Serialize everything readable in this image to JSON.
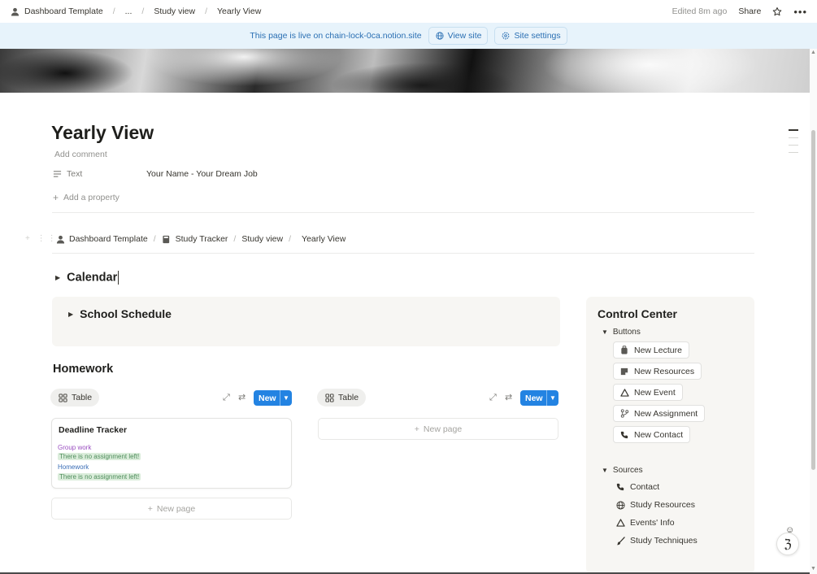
{
  "topbar": {
    "breadcrumb": [
      "Dashboard Template",
      "...",
      "Study view",
      "Yearly View"
    ],
    "edited": "Edited 8m ago",
    "share": "Share"
  },
  "banner": {
    "text": "This page is live on chain-lock-0ca.notion.site",
    "view_site": "View site",
    "site_settings": "Site settings"
  },
  "page": {
    "title": "Yearly View",
    "add_comment": "Add comment",
    "property_name": "Text",
    "property_value": "Your Name - Your Dream Job",
    "add_property": "Add a property"
  },
  "inner_breadcrumb": [
    "Dashboard Template",
    "Study Tracker",
    "Study view",
    "Yearly View"
  ],
  "calendar": {
    "label": "Calendar"
  },
  "school": {
    "label": "School Schedule"
  },
  "homework": {
    "heading": "Homework",
    "left_table": {
      "view": "Table",
      "new": "New",
      "card_title": "Deadline Tracker",
      "tags": [
        {
          "text": "Group work",
          "style": "purple"
        },
        {
          "text": "There is no assignment left!",
          "style": "green"
        },
        {
          "text": "Homework",
          "style": "blue"
        },
        {
          "text": "There is no assignment left!",
          "style": "green"
        }
      ],
      "new_page": "New page"
    },
    "right_table": {
      "view": "Table",
      "new": "New",
      "new_page": "New page"
    }
  },
  "control_center": {
    "title": "Control Center",
    "buttons_label": "Buttons",
    "buttons": [
      {
        "label": "New Lecture",
        "icon": "backpack-icon"
      },
      {
        "label": "New Resources",
        "icon": "note-icon"
      },
      {
        "label": "New Event",
        "icon": "warning-triangle-icon"
      },
      {
        "label": "New Assignment",
        "icon": "branch-icon"
      },
      {
        "label": "New Contact",
        "icon": "phone-icon"
      }
    ],
    "sources_label": "Sources",
    "sources": [
      {
        "label": "Contact",
        "icon": "phone-icon"
      },
      {
        "label": "Study Resources",
        "icon": "globe-icon"
      },
      {
        "label": "Events' Info",
        "icon": "warning-triangle-icon"
      },
      {
        "label": "Study Techniques",
        "icon": "brush-icon"
      }
    ]
  },
  "colors": {
    "accent": "#2383e2",
    "banner_bg": "#e7f3fb",
    "banner_text": "#2a6fb3",
    "panel_bg": "#f7f6f3"
  }
}
